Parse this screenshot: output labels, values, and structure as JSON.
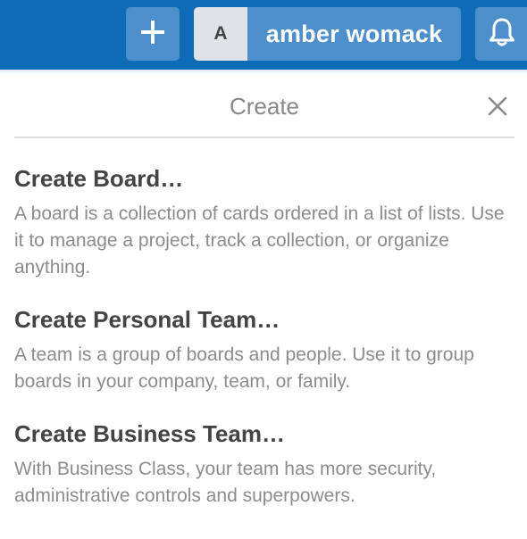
{
  "header": {
    "user_initial": "A",
    "user_name": "amber womack"
  },
  "icons": {
    "add": "plus-icon",
    "notifications": "bell-icon",
    "close": "close-icon"
  },
  "colors": {
    "header_bg": "#0e6bb5",
    "header_button_bg": "#4d8fcb"
  },
  "popover": {
    "title": "Create",
    "items": [
      {
        "title": "Create Board…",
        "description": "A board is a collection of cards ordered in a list of lists. Use it to manage a project, track a collection, or organize anything."
      },
      {
        "title": "Create Personal Team…",
        "description": "A team is a group of boards and people. Use it to group boards in your company, team, or family."
      },
      {
        "title": "Create Business Team…",
        "description": "With Business Class, your team has more security, administrative controls and superpowers."
      }
    ]
  }
}
